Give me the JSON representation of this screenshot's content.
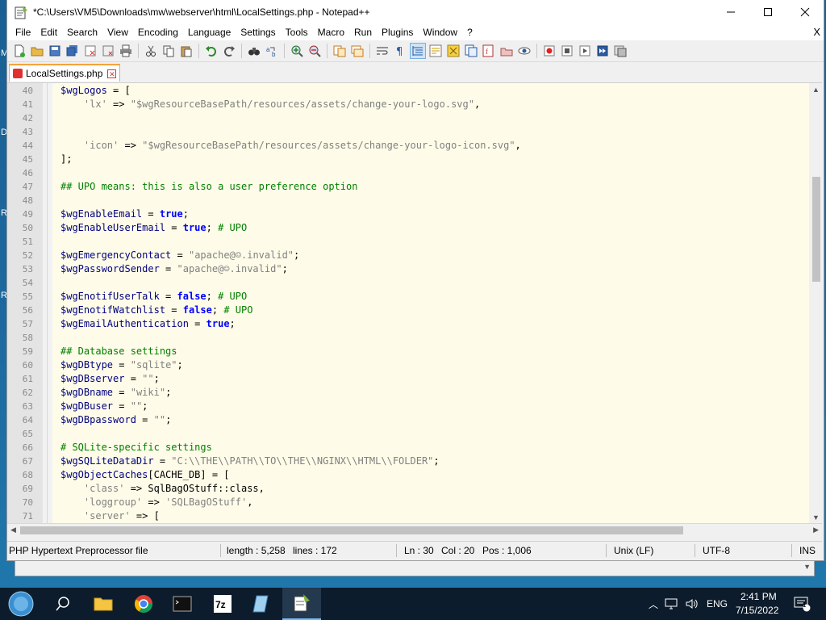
{
  "window": {
    "title": "*C:\\Users\\VM5\\Downloads\\mw\\webserver\\html\\LocalSettings.php - Notepad++"
  },
  "menu": [
    "File",
    "Edit",
    "Search",
    "View",
    "Encoding",
    "Language",
    "Settings",
    "Tools",
    "Macro",
    "Run",
    "Plugins",
    "Window",
    "?"
  ],
  "menu_close": "X",
  "tab": {
    "label": "LocalSettings.php"
  },
  "code": [
    {
      "n": "40",
      "t": "$wgLogos = ["
    },
    {
      "n": "41",
      "t": "    'lx' => \"$wgResourceBasePath/resources/assets/change-your-logo.svg\","
    },
    {
      "n": "42",
      "t": ""
    },
    {
      "n": "43",
      "t": ""
    },
    {
      "n": "44",
      "t": "    'icon' => \"$wgResourceBasePath/resources/assets/change-your-logo-icon.svg\","
    },
    {
      "n": "45",
      "t": "];"
    },
    {
      "n": "46",
      "t": ""
    },
    {
      "n": "47",
      "t": "## UPO means: this is also a user preference option"
    },
    {
      "n": "48",
      "t": ""
    },
    {
      "n": "49",
      "t": "$wgEnableEmail = true;"
    },
    {
      "n": "50",
      "t": "$wgEnableUserEmail = true; # UPO"
    },
    {
      "n": "51",
      "t": ""
    },
    {
      "n": "52",
      "t": "$wgEmergencyContact = \"apache@☺.invalid\";"
    },
    {
      "n": "53",
      "t": "$wgPasswordSender = \"apache@☺.invalid\";"
    },
    {
      "n": "54",
      "t": ""
    },
    {
      "n": "55",
      "t": "$wgEnotifUserTalk = false; # UPO"
    },
    {
      "n": "56",
      "t": "$wgEnotifWatchlist = false; # UPO"
    },
    {
      "n": "57",
      "t": "$wgEmailAuthentication = true;"
    },
    {
      "n": "58",
      "t": ""
    },
    {
      "n": "59",
      "t": "## Database settings"
    },
    {
      "n": "60",
      "t": "$wgDBtype = \"sqlite\";"
    },
    {
      "n": "61",
      "t": "$wgDBserver = \"\";"
    },
    {
      "n": "62",
      "t": "$wgDBname = \"wiki\";"
    },
    {
      "n": "63",
      "t": "$wgDBuser = \"\";"
    },
    {
      "n": "64",
      "t": "$wgDBpassword = \"\";"
    },
    {
      "n": "65",
      "t": ""
    },
    {
      "n": "66",
      "t": "# SQLite-specific settings"
    },
    {
      "n": "67",
      "t": "$wgSQLiteDataDir = \"C:\\\\THE\\\\PATH\\\\TO\\\\THE\\\\NGINX\\\\HTML\\\\FOLDER\";"
    },
    {
      "n": "68",
      "t": "$wgObjectCaches[CACHE_DB] = ["
    },
    {
      "n": "69",
      "t": "    'class' => SqlBagOStuff::class,"
    },
    {
      "n": "70",
      "t": "    'loggroup' => 'SQLBagOStuff',"
    },
    {
      "n": "71",
      "t": "    'server' => ["
    }
  ],
  "status": {
    "filetype": "PHP Hypertext Preprocessor file",
    "length": "length : 5,258",
    "lines": "lines : 172",
    "ln": "Ln : 30",
    "col": "Col : 20",
    "pos": "Pos : 1,006",
    "eol": "Unix (LF)",
    "encoding": "UTF-8",
    "mode": "INS"
  },
  "desktop_letters": [
    "M",
    "D",
    "R",
    "R"
  ],
  "taskbar": {
    "lang": "ENG",
    "time": "2:41 PM",
    "date": "7/15/2022",
    "notif_count": "1"
  },
  "colors": {
    "accent_tab": "#f4a33b",
    "gutter": "#e4e4e4",
    "editor_bg": "#fefce8",
    "taskbar": "#0c1c2c"
  }
}
